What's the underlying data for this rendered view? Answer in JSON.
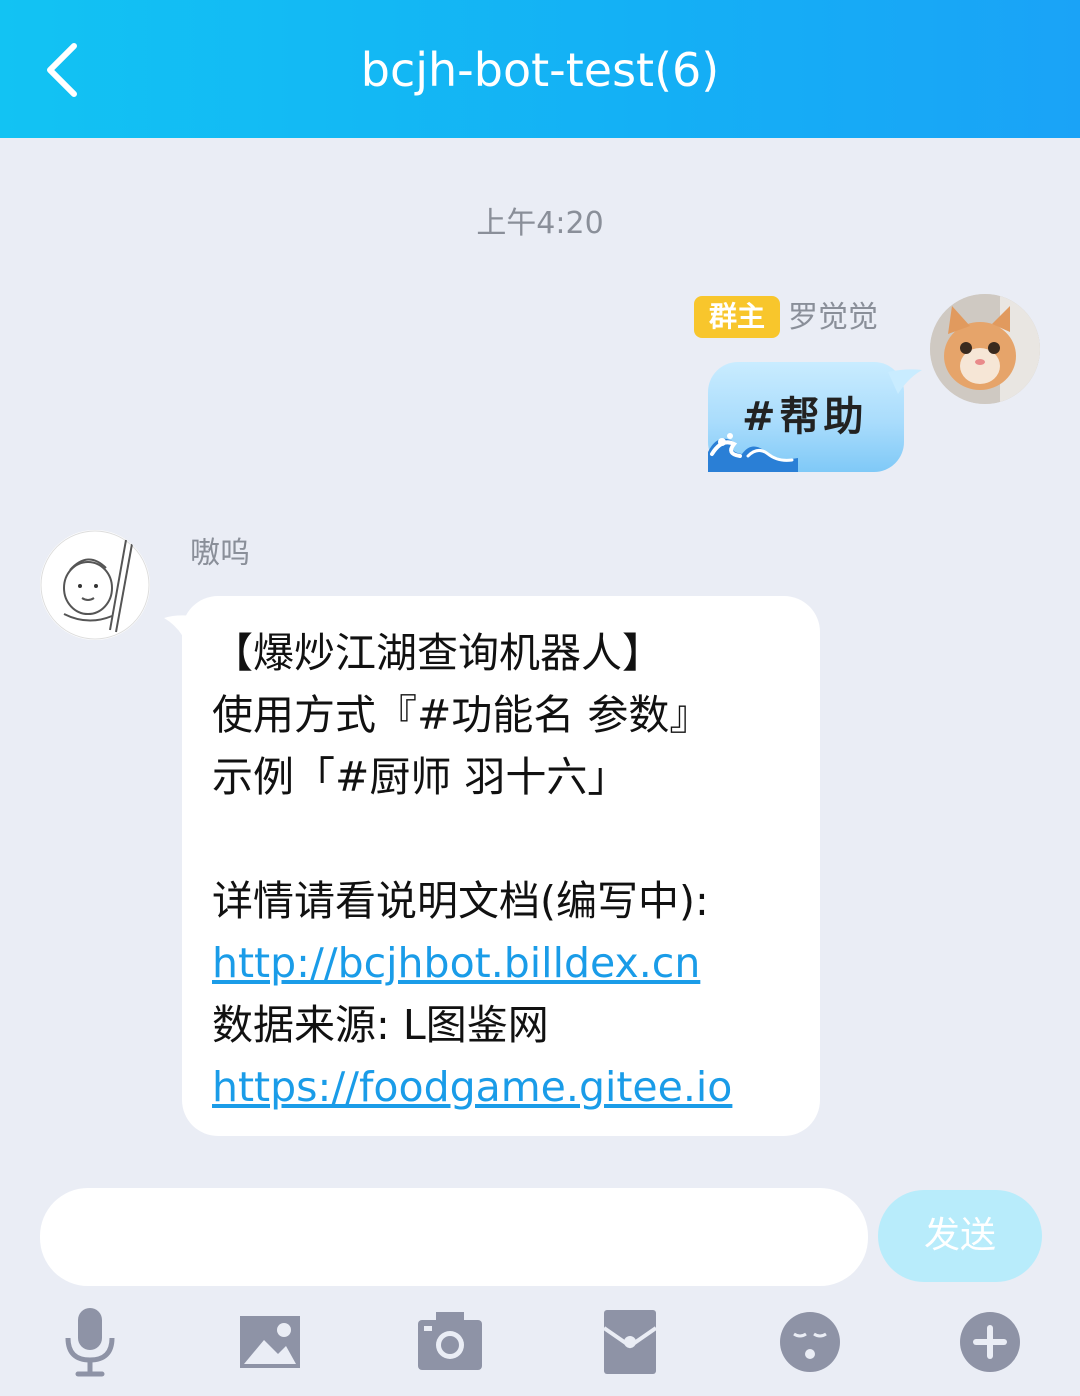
{
  "header": {
    "title": "bcjh-bot-test(6)"
  },
  "timestamp": "上午4:20",
  "messages": {
    "sent": {
      "badge": "群主",
      "sender": "罗觉觉",
      "text": "#帮助"
    },
    "received": {
      "sender": "嗷呜",
      "lines": {
        "l1": "【爆炒江湖查询机器人】",
        "l2": "使用方式『#功能名 参数』",
        "l3": "示例「#厨师 羽十六」",
        "l4": "详情请看说明文档(编写中):",
        "l5": "http://bcjhbot.billdex.cn",
        "l6": "数据来源: L图鉴网",
        "l7": "https://foodgame.gitee.io"
      }
    }
  },
  "composer": {
    "placeholder": "",
    "send_label": "发送"
  },
  "toolbar": {
    "icons": [
      "microphone-icon",
      "image-icon",
      "camera-icon",
      "red-packet-icon",
      "emoji-icon",
      "plus-icon"
    ]
  },
  "colors": {
    "header_gradient_start": "#12c3f3",
    "header_gradient_end": "#1aa3f7",
    "badge": "#f8c62c",
    "link": "#1a9ce8",
    "send_button": "#b8ecfb",
    "background": "#eaedf5"
  }
}
